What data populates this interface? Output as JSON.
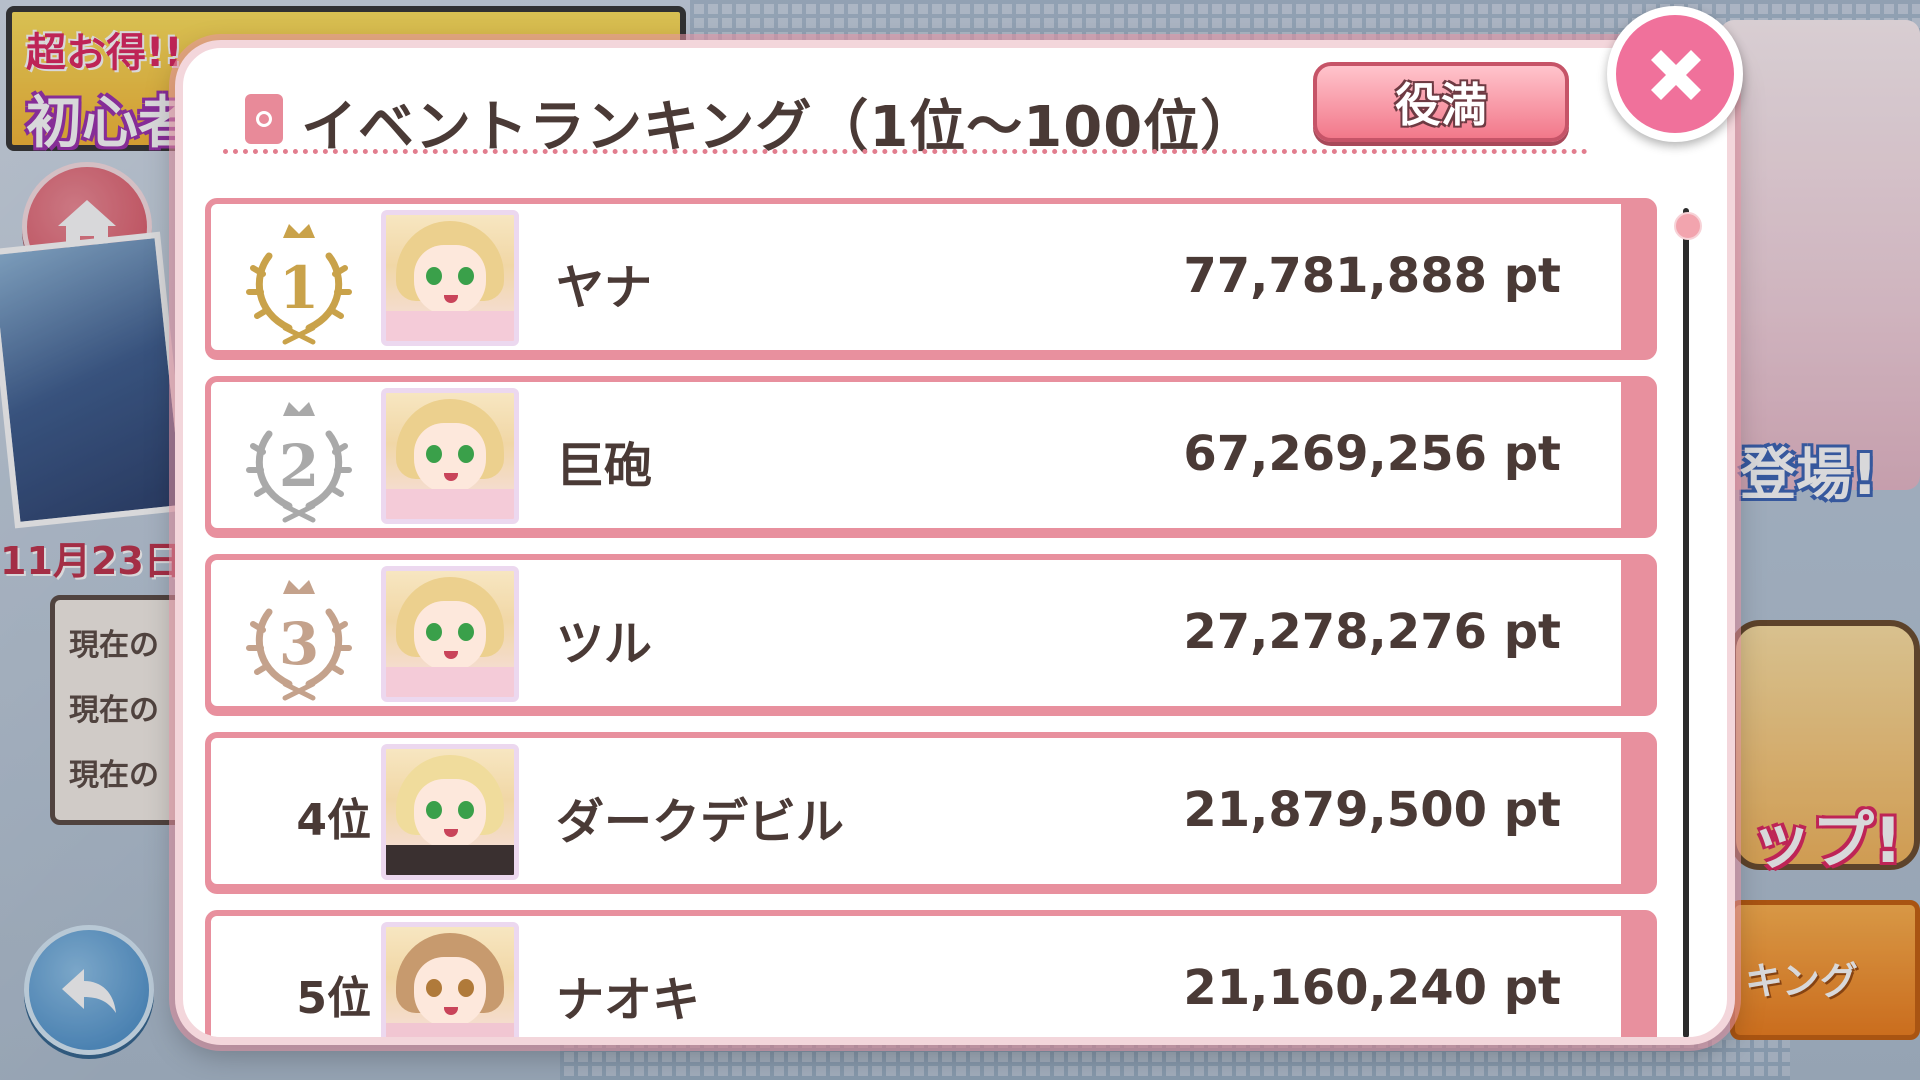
{
  "background": {
    "banner_sale": "超お得!!",
    "banner_beginner": "初心者",
    "date_text": "11月23日",
    "status_rows": [
      "現在の",
      "現在の",
      "現在の"
    ],
    "promo_appear": "登場!",
    "promo_up": "ップ!",
    "promo_rank": "キング"
  },
  "modal": {
    "title": "イベントランキング（1位～100位）",
    "role_button_label": "役満",
    "close_icon": "close-x-icon"
  },
  "rankings": [
    {
      "rank": "1",
      "rank_label": "",
      "badge": "gold",
      "name": "ヤナ",
      "score": "77,781,888 pt",
      "hair": "#ecd08e",
      "eye": "#3aa04a",
      "hood": "#f4cbd8"
    },
    {
      "rank": "2",
      "rank_label": "",
      "badge": "silver",
      "name": "巨砲",
      "score": "67,269,256 pt",
      "hair": "#ecd08e",
      "eye": "#3aa04a",
      "hood": "#f4cbd8"
    },
    {
      "rank": "3",
      "rank_label": "",
      "badge": "bronze",
      "name": "ツル",
      "score": "27,278,276 pt",
      "hair": "#ecd08e",
      "eye": "#3aa04a",
      "hood": "#f4cbd8"
    },
    {
      "rank": "4",
      "rank_label": "4位",
      "badge": "",
      "name": "ダークデビル",
      "score": "21,879,500 pt",
      "hair": "#f0dc9c",
      "eye": "#3aa04a",
      "hood": "#3a3030"
    },
    {
      "rank": "5",
      "rank_label": "5位",
      "badge": "",
      "name": "ナオキ",
      "score": "21,160,240 pt",
      "hair": "#c79a6e",
      "eye": "#b07a3a",
      "hood": "#f1c6d2"
    }
  ],
  "colors": {
    "accent_pink": "#e8909e",
    "close_pink": "#f0719b",
    "gold": "#c9a24a",
    "silver": "#a9a9a9",
    "bronze": "#c4a28c",
    "text_dark": "#4a3a36"
  },
  "scroll": {
    "position_fraction": 0.0
  }
}
